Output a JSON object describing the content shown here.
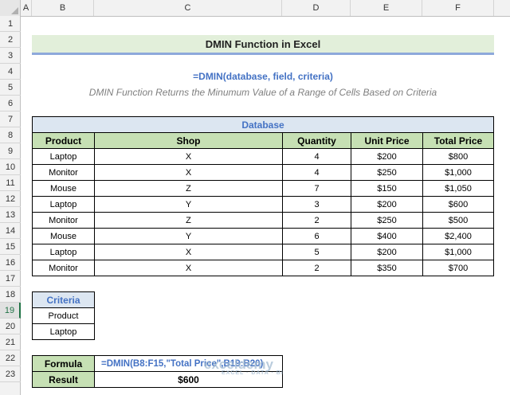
{
  "columns": [
    "A",
    "B",
    "C",
    "D",
    "E",
    "F"
  ],
  "rows": [
    "1",
    "2",
    "3",
    "4",
    "5",
    "6",
    "7",
    "8",
    "9",
    "10",
    "11",
    "12",
    "13",
    "14",
    "15",
    "16",
    "17",
    "18",
    "19",
    "20",
    "21",
    "22",
    "23"
  ],
  "title": "DMIN Function in Excel",
  "syntax": "=DMIN(database, field, criteria)",
  "description": "DMIN Function Returns the Minumum Value of a Range of Cells Based on Criteria",
  "database": {
    "caption": "Database",
    "headers": [
      "Product",
      "Shop",
      "Quantity",
      "Unit Price",
      "Total Price"
    ],
    "rows": [
      [
        "Laptop",
        "X",
        "4",
        "$200",
        "$800"
      ],
      [
        "Monitor",
        "X",
        "4",
        "$250",
        "$1,000"
      ],
      [
        "Mouse",
        "Z",
        "7",
        "$150",
        "$1,050"
      ],
      [
        "Laptop",
        "Y",
        "3",
        "$200",
        "$600"
      ],
      [
        "Monitor",
        "Z",
        "2",
        "$250",
        "$500"
      ],
      [
        "Mouse",
        "Y",
        "6",
        "$400",
        "$2,400"
      ],
      [
        "Laptop",
        "X",
        "5",
        "$200",
        "$1,000"
      ],
      [
        "Monitor",
        "X",
        "2",
        "$350",
        "$700"
      ]
    ]
  },
  "criteria": {
    "header": "Criteria",
    "values": [
      "Product",
      "Laptop"
    ]
  },
  "formula_block": {
    "formula_label": "Formula",
    "formula_text": "=DMIN(B8:F15,\"Total Price\",B19:B20)",
    "result_label": "Result",
    "result_value": "$600"
  },
  "watermark": {
    "brand": "exceldemy",
    "tagline": "EXCEL · DATA · BI"
  },
  "colors": {
    "header_fill": "#c6e0b4",
    "title_fill": "#e2efda",
    "accent_blue": "#4472c4",
    "database_fill": "#dce6f1"
  }
}
